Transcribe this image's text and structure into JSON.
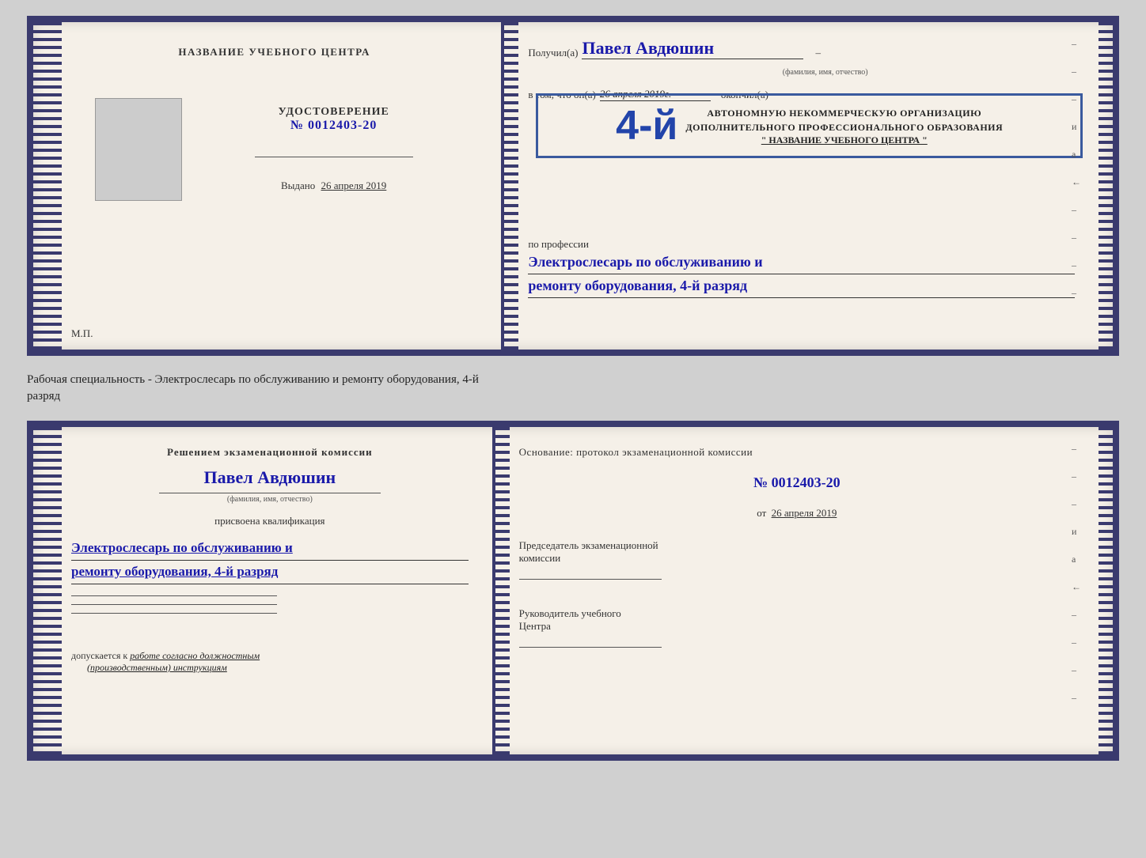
{
  "top_cert": {
    "left": {
      "title": "НАЗВАНИЕ УЧЕБНОГО ЦЕНТРА",
      "photo_alt": "фото",
      "udostoverenie_label": "УДОСТОВЕРЕНИЕ",
      "number": "№ 0012403-20",
      "vydano_label": "Выдано",
      "vydano_date": "26 апреля 2019",
      "mp": "М.П."
    },
    "right": {
      "poluchil_prefix": "Получил(а)",
      "recipient_name": "Павел Авдюшин",
      "fio_label": "(фамилия, имя, отчество)",
      "vtom_prefix": "в том, что он(а)",
      "date_value": "26 апреля 2019г.",
      "okончил": "окончил(а)",
      "stamp_grade": "4-й",
      "stamp_line2": "АВТОНОМНУЮ НЕКОММЕРЧЕСКУЮ ОРГАНИЗАЦИЮ",
      "stamp_line3": "ДОПОЛНИТЕЛЬНОГО ПРОФЕССИОНАЛЬНОГО ОБРАЗОВАНИЯ",
      "stamp_name": "\" НАЗВАНИЕ УЧЕБНОГО ЦЕНТРА \"",
      "po_professii": "по профессии",
      "profession_line1": "Электрослесарь по обслуживанию и",
      "profession_line2": "ремонту оборудования, 4-й разряд"
    }
  },
  "between_label": {
    "line1": "Рабочая специальность - Электрослесарь по обслуживанию и ремонту оборудования, 4-й",
    "line2": "разряд"
  },
  "bottom_cert": {
    "left": {
      "resheniem": "Решением экзаменационной комиссии",
      "name": "Павел Авдюшин",
      "fio_label": "(фамилия, имя, отчество)",
      "prisvoena": "присвоена квалификация",
      "qualification_line1": "Электрослесарь по обслуживанию и",
      "qualification_line2": "ремонту оборудования, 4-й разряд",
      "dopuskaetsya_prefix": "допускается к",
      "dopuskaetsya_value": "работе согласно должностным",
      "dopuskaetsya_value2": "(производственным) инструкциям"
    },
    "right": {
      "osnovanie": "Основание: протокол экзаменационной  комиссии",
      "number": "№  0012403-20",
      "ot_prefix": "от",
      "ot_date": "26 апреля 2019",
      "predsedatel_line1": "Председатель экзаменационной",
      "predsedatel_line2": "комиссии",
      "rukovoditel_line1": "Руководитель учебного",
      "rukovoditel_line2": "Центра"
    }
  },
  "side_dashes": [
    "-",
    "-",
    "-",
    "и",
    "а",
    "←",
    "-",
    "-",
    "-",
    "-"
  ]
}
